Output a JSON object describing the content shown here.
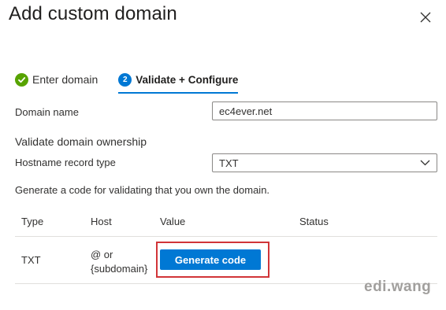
{
  "dialog": {
    "title": "Add custom domain",
    "close_icon": "close-icon"
  },
  "steps": [
    {
      "label": "Enter domain",
      "state": "completed",
      "icon": "check-circle-icon"
    },
    {
      "label": "Validate + Configure",
      "number": "2",
      "state": "active"
    }
  ],
  "form": {
    "domain_name_label": "Domain name",
    "domain_name_value": "ec4ever.net",
    "validate_heading": "Validate domain ownership",
    "hostname_record_type_label": "Hostname record type",
    "hostname_record_type_value": "TXT",
    "generate_description": "Generate a code for validating that you own the domain."
  },
  "table": {
    "headers": [
      "Type",
      "Host",
      "Value",
      "Status"
    ],
    "rows": [
      {
        "type": "TXT",
        "host_line1": "@ or",
        "host_line2": "{subdomain}",
        "value_button_label": "Generate code",
        "status": ""
      }
    ]
  },
  "watermark": "edi.wang",
  "colors": {
    "accent": "#0078d4",
    "success": "#57a300",
    "highlight_border": "#d13438",
    "watermark": "#a19f9d"
  }
}
